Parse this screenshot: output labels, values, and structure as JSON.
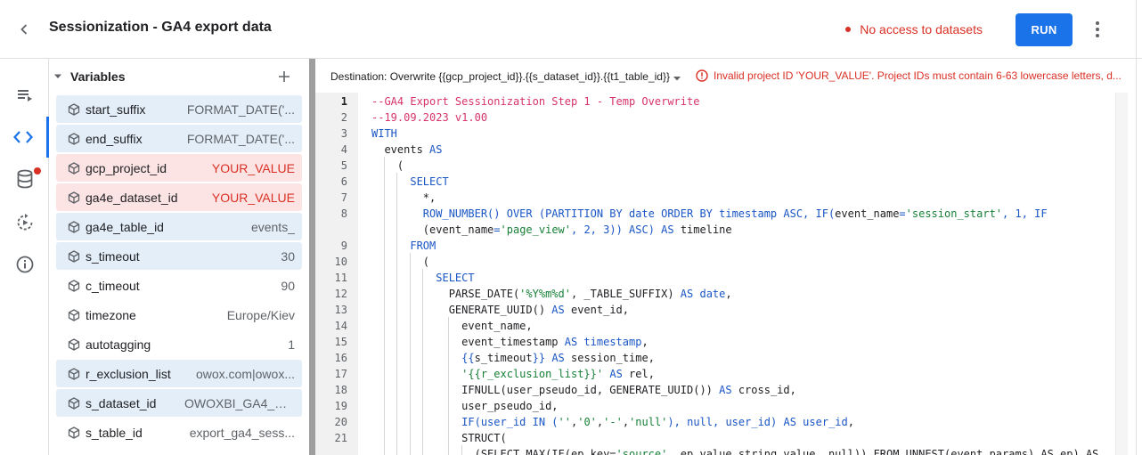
{
  "header": {
    "title": "Sessionization - GA4 export data",
    "access_warning": "No access to datasets",
    "run_label": "RUN"
  },
  "rail": {
    "items": [
      "queue-icon",
      "code-icon",
      "database-icon",
      "history-play-icon",
      "info-icon"
    ],
    "active": "code-icon",
    "badge_on": "database-icon"
  },
  "variables": {
    "title": "Variables",
    "items": [
      {
        "name": "start_suffix",
        "value": "FORMAT_DATE('...",
        "state": "blue"
      },
      {
        "name": "end_suffix",
        "value": "FORMAT_DATE('...",
        "state": "blue"
      },
      {
        "name": "gcp_project_id",
        "value": "YOUR_VALUE",
        "state": "red"
      },
      {
        "name": "ga4e_dataset_id",
        "value": "YOUR_VALUE",
        "state": "red"
      },
      {
        "name": "ga4e_table_id",
        "value": "events_",
        "state": "blue"
      },
      {
        "name": "s_timeout",
        "value": "30",
        "state": "blue"
      },
      {
        "name": "c_timeout",
        "value": "90",
        "state": "plain"
      },
      {
        "name": "timezone",
        "value": "Europe/Kiev",
        "state": "plain"
      },
      {
        "name": "autotagging",
        "value": "1",
        "state": "plain"
      },
      {
        "name": "r_exclusion_list",
        "value": "owox.com|owox...",
        "state": "blue"
      },
      {
        "name": "s_dataset_id",
        "value": "OWOXBI_GA4_St...",
        "state": "blue"
      },
      {
        "name": "s_table_id",
        "value": "export_ga4_sess...",
        "state": "plain"
      }
    ]
  },
  "destination": {
    "label": "Destination: Overwrite {{gcp_project_id}}.{{s_dataset_id}}.{{t1_table_id}}",
    "error": "Invalid project ID 'YOUR_VALUE'. Project IDs must contain 6-63 lowercase letters, d..."
  },
  "editor": {
    "current_line": "1",
    "line_numbers": [
      "1",
      "2",
      "3",
      "4",
      "5",
      "6",
      "7",
      "8",
      "9",
      "10",
      "11",
      "12",
      "13",
      "14",
      "15",
      "16",
      "17",
      "18",
      "19",
      "20",
      "21"
    ],
    "lines": [
      [
        {
          "t": "--GA4 Export Sessionization Step 1 - Temp Overwrite",
          "c": "com"
        }
      ],
      [
        {
          "t": "--19.09.2023 v1.00",
          "c": "com"
        }
      ],
      [
        {
          "t": "WITH",
          "c": "kw"
        }
      ],
      [
        {
          "t": "  events "
        },
        {
          "t": "AS",
          "c": "kw"
        }
      ],
      [
        {
          "t": "    ("
        }
      ],
      [
        {
          "t": "      "
        },
        {
          "t": "SELECT",
          "c": "kw"
        }
      ],
      [
        {
          "t": "        *,"
        }
      ],
      [
        {
          "t": "        "
        },
        {
          "t": "ROW_NUMBER() OVER (PARTITION BY date ORDER BY timestamp ASC, IF(",
          "c": "kw"
        },
        {
          "t": "event_name"
        },
        {
          "t": "=",
          "c": "kw"
        },
        {
          "t": "'session_start'",
          "c": "str"
        },
        {
          "t": ", 1, IF",
          "c": "kw"
        }
      ],
      [
        {
          "t": "        ("
        },
        {
          "t": "event_name"
        },
        {
          "t": "=",
          "c": "kw"
        },
        {
          "t": "'page_view'",
          "c": "str"
        },
        {
          "t": ", 2, 3)) ASC) AS",
          "c": "kw"
        },
        {
          "t": " timeline"
        }
      ],
      [
        {
          "t": "      "
        },
        {
          "t": "FROM",
          "c": "kw"
        }
      ],
      [
        {
          "t": "        ("
        }
      ],
      [
        {
          "t": "          "
        },
        {
          "t": "SELECT",
          "c": "kw"
        }
      ],
      [
        {
          "t": "            PARSE_DATE("
        },
        {
          "t": "'%Y%m%d'",
          "c": "str"
        },
        {
          "t": ", _TABLE_SUFFIX) "
        },
        {
          "t": "AS date",
          "c": "kw"
        },
        {
          "t": ","
        }
      ],
      [
        {
          "t": "            GENERATE_UUID() "
        },
        {
          "t": "AS",
          "c": "kw"
        },
        {
          "t": " event_id,"
        }
      ],
      [
        {
          "t": "              event_name,"
        }
      ],
      [
        {
          "t": "              event_timestamp "
        },
        {
          "t": "AS timestamp",
          "c": "kw"
        },
        {
          "t": ","
        }
      ],
      [
        {
          "t": "              "
        },
        {
          "t": "{{",
          "c": "kw"
        },
        {
          "t": "s_timeout"
        },
        {
          "t": "}}",
          "c": "kw"
        },
        {
          "t": " "
        },
        {
          "t": "AS",
          "c": "kw"
        },
        {
          "t": " session_time,"
        }
      ],
      [
        {
          "t": "              "
        },
        {
          "t": "'{{r_exclusion_list}}'",
          "c": "str"
        },
        {
          "t": " "
        },
        {
          "t": "AS",
          "c": "kw"
        },
        {
          "t": " rel,"
        }
      ],
      [
        {
          "t": "              IFNULL(user_pseudo_id, GENERATE_UUID()) "
        },
        {
          "t": "AS",
          "c": "kw"
        },
        {
          "t": " cross_id,"
        }
      ],
      [
        {
          "t": "              user_pseudo_id,"
        }
      ],
      [
        {
          "t": "              "
        },
        {
          "t": "IF(user_id IN (",
          "c": "kw"
        },
        {
          "t": "''",
          "c": "str"
        },
        {
          "t": ","
        },
        {
          "t": "'0'",
          "c": "str"
        },
        {
          "t": ","
        },
        {
          "t": "'-'",
          "c": "str"
        },
        {
          "t": ","
        },
        {
          "t": "'null'",
          "c": "str"
        },
        {
          "t": "), null, user_id) AS user_id",
          "c": "kw"
        },
        {
          "t": ","
        }
      ],
      [
        {
          "t": "              STRUCT("
        }
      ],
      [
        {
          "t": "                (SELECT MAX(IF(ep.key="
        },
        {
          "t": "'source'",
          "c": "str"
        },
        {
          "t": ", ep.value.string_value, null)) FROM UNNEST(event_params) AS ep) AS"
        }
      ]
    ]
  }
}
